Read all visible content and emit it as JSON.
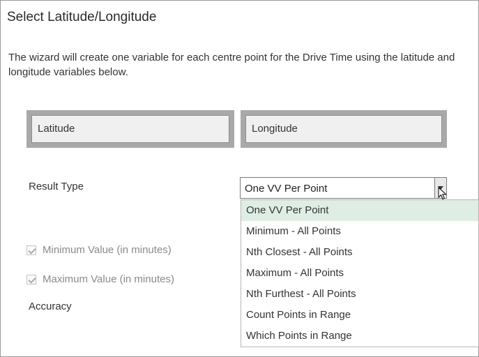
{
  "dialog": {
    "title": "Select Latitude/Longitude",
    "description": "The wizard will create one variable for each centre point for the Drive Time using the latitude and longitude variables below."
  },
  "fields": {
    "latitude": "Latitude",
    "longitude": "Longitude"
  },
  "result_type": {
    "label": "Result Type",
    "selected": "One VV Per Point",
    "options": [
      "One VV Per Point",
      "Minimum - All Points",
      "Nth Closest - All Points",
      "Maximum - All Points",
      "Nth Furthest - All Points",
      "Count Points in Range",
      "Which Points in Range"
    ]
  },
  "checkboxes": {
    "min_value": {
      "label": "Minimum Value (in minutes)",
      "checked": true
    },
    "max_value": {
      "label": "Maximum Value (in minutes)",
      "checked": true
    }
  },
  "accuracy": {
    "label": "Accuracy"
  }
}
